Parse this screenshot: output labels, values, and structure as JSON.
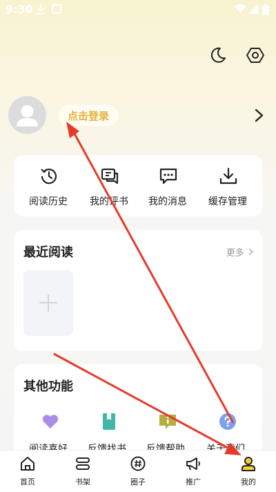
{
  "status_bar": {
    "time": "9:30"
  },
  "header": {
    "login_label": "点击登录"
  },
  "quick_actions": [
    {
      "label": "阅读历史",
      "icon": "history-icon"
    },
    {
      "label": "我的评书",
      "icon": "comment-icon"
    },
    {
      "label": "我的消息",
      "icon": "message-icon"
    },
    {
      "label": "缓存管理",
      "icon": "download-icon"
    }
  ],
  "recent": {
    "title": "最近阅读",
    "more": "更多"
  },
  "other": {
    "title": "其他功能",
    "items": [
      {
        "label": "阅读喜好",
        "icon": "heart-icon",
        "color": "#a98ee8"
      },
      {
        "label": "反馈找书",
        "icon": "bookmark-icon",
        "color": "#3fb8a5"
      },
      {
        "label": "反馈帮助",
        "icon": "info-icon",
        "color": "#b5ad3e"
      },
      {
        "label": "关于我们",
        "icon": "question-icon",
        "color": "#7fa0ee"
      }
    ]
  },
  "bottom_nav": [
    {
      "label": "首页",
      "icon": "home-icon"
    },
    {
      "label": "书架",
      "icon": "bookshelf-icon"
    },
    {
      "label": "圈子",
      "icon": "hashtag-icon"
    },
    {
      "label": "推广",
      "icon": "megaphone-icon"
    },
    {
      "label": "我的",
      "icon": "profile-icon",
      "active": true
    }
  ],
  "colors": {
    "accent": "#f6d03b",
    "login_text": "#e7b13a",
    "annotation_arrow": "#e53a2a"
  }
}
